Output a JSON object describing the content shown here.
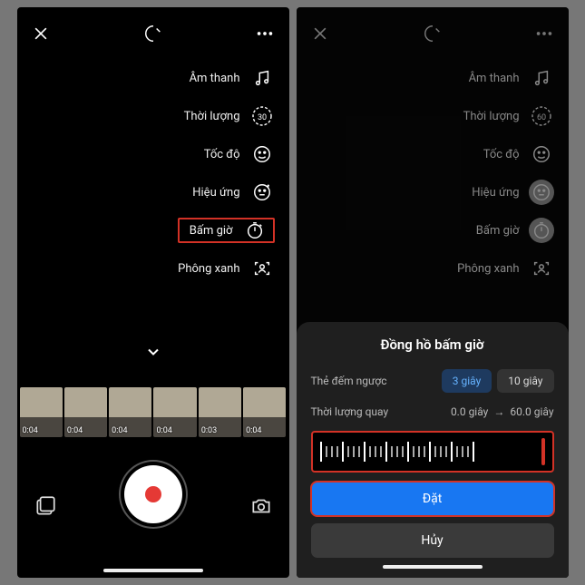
{
  "left": {
    "menu": [
      {
        "label": "Âm thanh",
        "icon": "music"
      },
      {
        "label": "Thời lượng",
        "icon": "duration",
        "badge": "30"
      },
      {
        "label": "Tốc độ",
        "icon": "speed"
      },
      {
        "label": "Hiệu ứng",
        "icon": "effects"
      },
      {
        "label": "Bấm giờ",
        "icon": "timer",
        "highlight": true
      },
      {
        "label": "Phông xanh",
        "icon": "greenscreen"
      }
    ],
    "clips": [
      "0:04",
      "0:04",
      "0:04",
      "0:04",
      "0:03",
      "0:04"
    ]
  },
  "right": {
    "menu": [
      {
        "label": "Âm thanh",
        "icon": "music"
      },
      {
        "label": "Thời lượng",
        "icon": "duration",
        "badge": "60"
      },
      {
        "label": "Tốc độ",
        "icon": "speed"
      },
      {
        "label": "Hiệu ứng",
        "icon": "effects",
        "selected": true
      },
      {
        "label": "Bấm giờ",
        "icon": "timer",
        "selected": true
      },
      {
        "label": "Phông xanh",
        "icon": "greenscreen"
      }
    ],
    "sheet": {
      "title": "Đồng hồ bấm giờ",
      "countdown_label": "Thẻ đếm ngược",
      "seg1": "3 giây",
      "seg2": "10 giây",
      "duration_label": "Thời lượng quay",
      "from": "0.0 giây",
      "to": "60.0 giây",
      "set": "Đặt",
      "cancel": "Hủy"
    }
  }
}
